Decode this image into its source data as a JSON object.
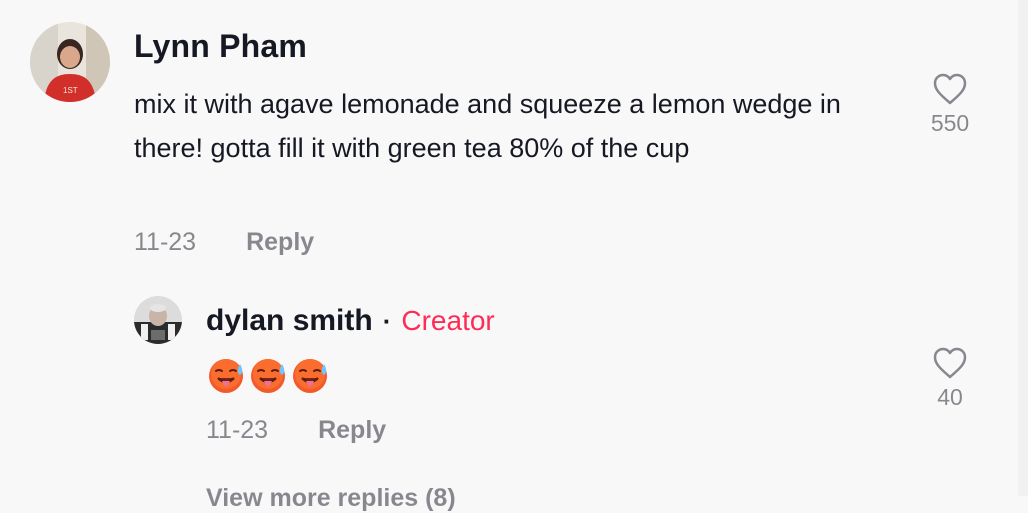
{
  "comment": {
    "username": "Lynn Pham",
    "text": "mix it with agave lemonade and squeeze a lemon wedge in there! gotta fill it with green tea 80% of the cup",
    "date": "11-23",
    "reply_label": "Reply",
    "like_count": "550",
    "avatar_icon": "user-avatar-photo",
    "like_icon": "heart-outline-icon"
  },
  "reply": {
    "username": "dylan smith",
    "separator": "·",
    "badge": "Creator",
    "badge_color": "#fe2c55",
    "emojis": [
      "hot-face-emoji",
      "hot-face-emoji",
      "hot-face-emoji"
    ],
    "date": "11-23",
    "reply_label": "Reply",
    "like_count": "40",
    "avatar_icon": "user-avatar-photo",
    "like_icon": "heart-outline-icon"
  },
  "view_more": {
    "label": "View more replies (8)"
  }
}
